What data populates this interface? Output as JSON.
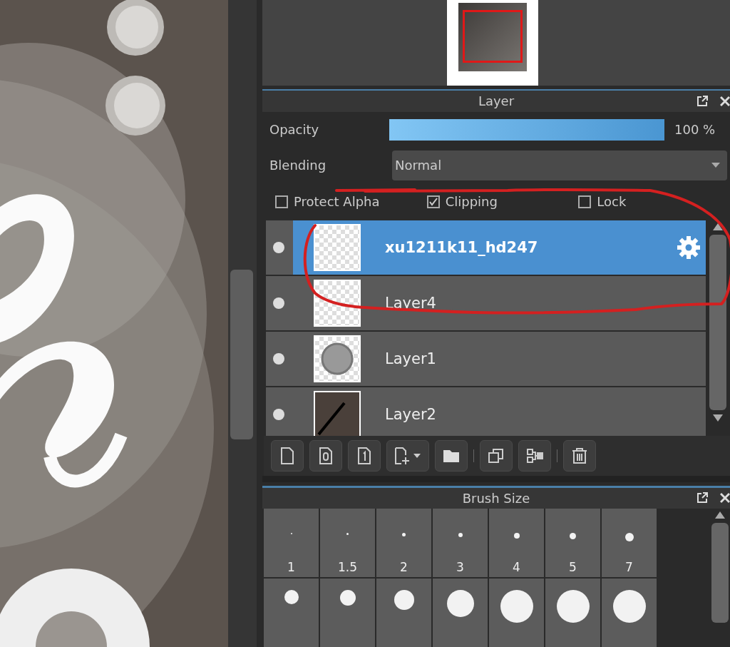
{
  "layer_panel": {
    "title": "Layer",
    "opacity": {
      "label": "Opacity",
      "level": 1,
      "reading": "100 %"
    },
    "blending": {
      "label": "Blending",
      "value": "Normal"
    },
    "options": [
      {
        "label": "Protect Alpha",
        "checked": false
      },
      {
        "label": "Clipping",
        "checked": true
      },
      {
        "label": "Lock",
        "checked": false
      }
    ],
    "layers": [
      {
        "name": "xu1211k11_hd247",
        "selected": true,
        "visible": true,
        "kind": "empty"
      },
      {
        "name": "Layer4",
        "selected": false,
        "visible": true,
        "kind": "empty"
      },
      {
        "name": "Layer1",
        "selected": false,
        "visible": true,
        "kind": "circle"
      },
      {
        "name": "Layer2",
        "selected": false,
        "visible": true,
        "kind": "stroke"
      }
    ]
  },
  "brush_size_panel": {
    "title": "Brush Size",
    "sizes": [
      {
        "label": "1"
      },
      {
        "label": "1.5"
      },
      {
        "label": "2"
      },
      {
        "label": "3"
      },
      {
        "label": "4"
      },
      {
        "label": "5"
      },
      {
        "label": "7"
      }
    ]
  }
}
